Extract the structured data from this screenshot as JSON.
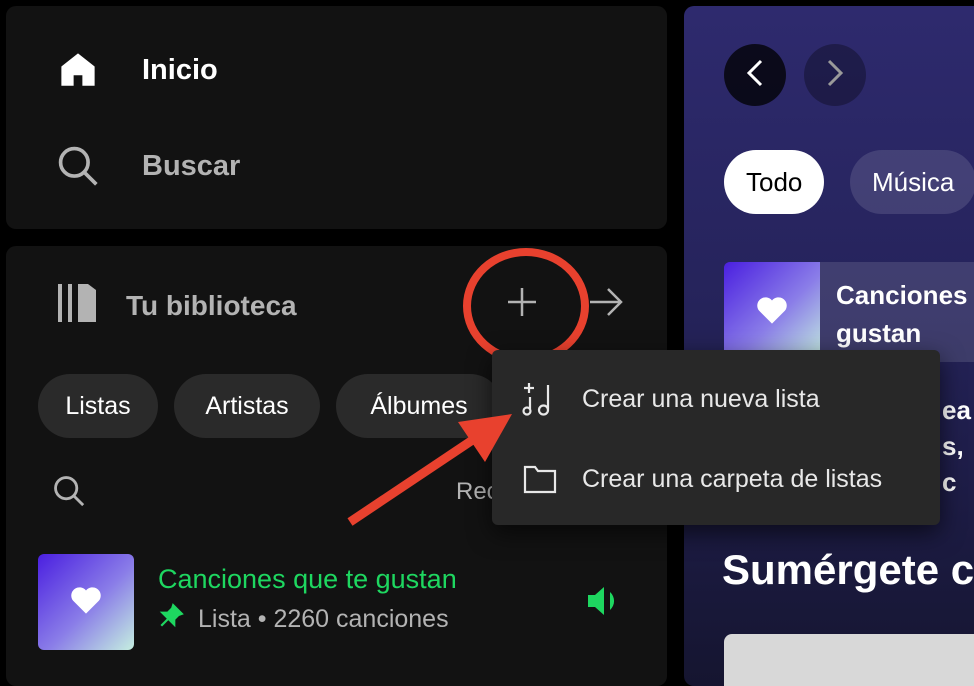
{
  "nav": {
    "home_label": "Inicio",
    "search_label": "Buscar"
  },
  "library": {
    "title": "Tu biblioteca",
    "filters": [
      "Listas",
      "Artistas",
      "Álbumes"
    ],
    "sort_label": "Rec",
    "items": [
      {
        "title": "Canciones que te gustan",
        "subtitle": "Lista • 2260 canciones",
        "pinned": true,
        "playing": true
      }
    ]
  },
  "dropdown": {
    "items": [
      {
        "label": "Crear una nueva lista",
        "icon": "music-note-plus-icon"
      },
      {
        "label": "Crear una carpeta de listas",
        "icon": "folder-icon"
      }
    ]
  },
  "main": {
    "filters": [
      "Todo",
      "Música"
    ],
    "card_title": "Canciones que te gustan",
    "card_title_visible_line1": "Canciones",
    "card_title_visible_line2": "gustan",
    "partial_text_line1": "ea",
    "partial_text_line2": "s, c",
    "section_title": "Sumérgete c"
  },
  "colors": {
    "accent_green": "#1ed760",
    "annotation_red": "#e8412e",
    "background": "#121212",
    "menu_background": "#282828"
  }
}
